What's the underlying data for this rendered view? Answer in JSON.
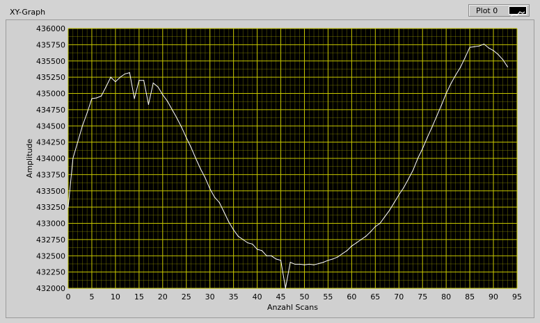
{
  "window": {
    "graph_title": "XY-Graph",
    "legend_label": "Plot 0"
  },
  "colors": {
    "plot_background": "#000000",
    "grid": "#c8c800",
    "line": "#ffffff",
    "panel": "#d3d3d3"
  },
  "icons": {
    "legend_swatch": "line-plot-icon"
  },
  "chart_data": {
    "type": "line",
    "title": "",
    "xlabel": "Anzahl Scans",
    "ylabel": "Amplitude",
    "xlim": [
      0,
      95
    ],
    "ylim": [
      432000,
      436000
    ],
    "xticks": [
      0,
      5,
      10,
      15,
      20,
      25,
      30,
      35,
      40,
      45,
      50,
      55,
      60,
      65,
      70,
      75,
      80,
      85,
      90,
      95
    ],
    "yticks": [
      432000,
      432250,
      432500,
      432750,
      433000,
      433250,
      433500,
      433750,
      434000,
      434250,
      434500,
      434750,
      435000,
      435250,
      435500,
      435750,
      436000
    ],
    "x_minor_step": 1,
    "y_minor_step": 125,
    "grid": true,
    "series": [
      {
        "name": "Plot 0",
        "x": [
          0,
          1,
          2,
          3,
          4,
          5,
          6,
          7,
          8,
          9,
          10,
          11,
          12,
          13,
          14,
          15,
          16,
          17,
          18,
          19,
          20,
          21,
          22,
          23,
          24,
          25,
          26,
          27,
          28,
          29,
          30,
          31,
          32,
          33,
          34,
          35,
          36,
          37,
          38,
          39,
          40,
          41,
          42,
          43,
          44,
          45,
          46,
          47,
          48,
          49,
          50,
          51,
          52,
          53,
          54,
          55,
          56,
          57,
          58,
          59,
          60,
          61,
          62,
          63,
          64,
          65,
          66,
          67,
          68,
          69,
          70,
          71,
          72,
          73,
          74,
          75,
          76,
          77,
          78,
          79,
          80,
          81,
          82,
          83,
          84,
          85,
          86,
          87,
          88,
          89,
          90,
          91,
          92,
          93
        ],
        "y": [
          433250,
          434000,
          434250,
          434500,
          434700,
          434920,
          434930,
          434960,
          435100,
          435250,
          435180,
          435250,
          435300,
          435320,
          434920,
          435200,
          435200,
          434830,
          435160,
          435100,
          434980,
          434880,
          434750,
          434620,
          434480,
          434320,
          434170,
          434000,
          433840,
          433700,
          433530,
          433400,
          433320,
          433170,
          433020,
          432900,
          432800,
          432750,
          432700,
          432680,
          432600,
          432580,
          432500,
          432500,
          432450,
          432430,
          432000,
          432400,
          432370,
          432370,
          432360,
          432370,
          432360,
          432380,
          432400,
          432430,
          432450,
          432480,
          432530,
          432580,
          432650,
          432700,
          432750,
          432800,
          432870,
          432950,
          433000,
          433100,
          433200,
          433320,
          433440,
          433550,
          433680,
          433820,
          434000,
          434150,
          434320,
          434480,
          434650,
          434820,
          435000,
          435150,
          435280,
          435400,
          435550,
          435710,
          435720,
          435730,
          435760,
          435700,
          435660,
          435600,
          435520,
          435410
        ]
      }
    ]
  }
}
